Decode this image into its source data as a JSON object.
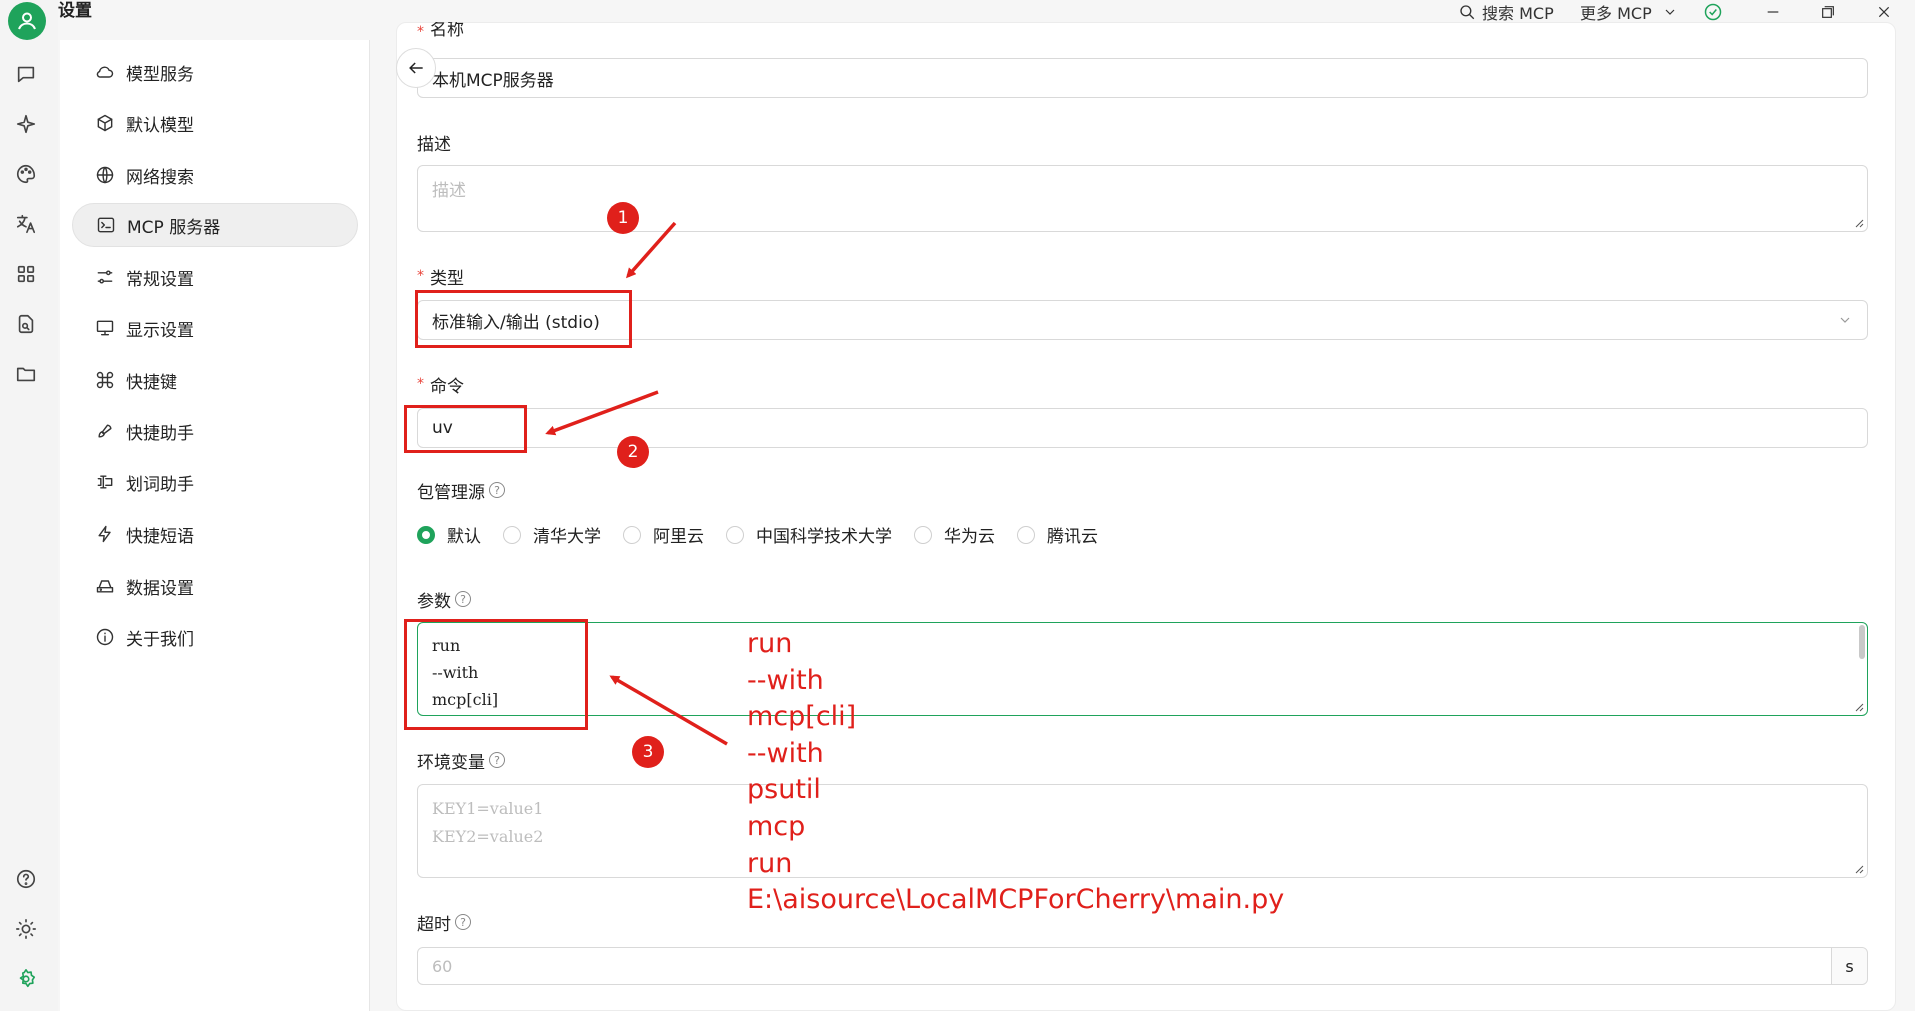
{
  "app": {
    "title": "设置"
  },
  "topbar": {
    "search_mcp": "搜索 MCP",
    "more_mcp": "更多 MCP"
  },
  "nav": {
    "items": [
      {
        "label": "模型服务",
        "icon": "cloud-icon"
      },
      {
        "label": "默认模型",
        "icon": "cube-icon"
      },
      {
        "label": "网络搜索",
        "icon": "globe-icon"
      },
      {
        "label": "MCP 服务器",
        "icon": "terminal-icon",
        "active": true
      },
      {
        "label": "常规设置",
        "icon": "settings-sliders-icon"
      },
      {
        "label": "显示设置",
        "icon": "monitor-icon"
      },
      {
        "label": "快捷键",
        "icon": "command-icon"
      },
      {
        "label": "快捷助手",
        "icon": "rocket-icon"
      },
      {
        "label": "划词助手",
        "icon": "text-select-icon"
      },
      {
        "label": "快捷短语",
        "icon": "zap-icon"
      },
      {
        "label": "数据设置",
        "icon": "hard-drive-icon"
      },
      {
        "label": "关于我们",
        "icon": "info-icon"
      }
    ]
  },
  "form": {
    "name_label": "名称",
    "name_value": "本机MCP服务器",
    "desc_label": "描述",
    "desc_placeholder": "描述",
    "type_label": "类型",
    "type_value": "标准输入/输出 (stdio)",
    "cmd_label": "命令",
    "cmd_value": "uv",
    "registry_label": "包管理源",
    "registry_options": [
      "默认",
      "清华大学",
      "阿里云",
      "中国科学技术大学",
      "华为云",
      "腾讯云"
    ],
    "registry_selected": "默认",
    "args_label": "参数",
    "args_lines": [
      "run",
      "--with",
      "mcp[cli]"
    ],
    "env_label": "环境变量",
    "env_placeholder_lines": [
      "KEY1=value1",
      "KEY2=value2"
    ],
    "timeout_label": "超时",
    "timeout_placeholder": "60",
    "timeout_unit": "s"
  },
  "annotations": {
    "badges": [
      "1",
      "2",
      "3"
    ],
    "note_lines": [
      "run",
      "--with",
      "mcp[cli]",
      "--with",
      "psutil",
      "mcp",
      "run",
      "E:\\aisource\\LocalMCPForCherry\\main.py"
    ],
    "color": "#e0201b"
  },
  "colors": {
    "accent": "#1fa35b",
    "annotation": "#e0201b"
  }
}
